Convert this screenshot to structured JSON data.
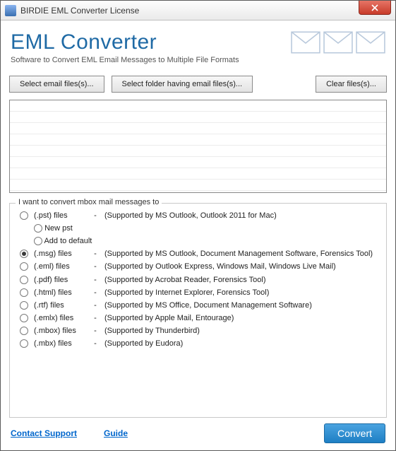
{
  "window": {
    "title": "BIRDIE EML Converter License"
  },
  "header": {
    "title": "EML Converter",
    "subtitle": "Software to Convert EML Email Messages to Multiple File Formats"
  },
  "buttons": {
    "select_files": "Select email files(s)...",
    "select_folder": "Select folder having email files(s)...",
    "clear": "Clear files(s)..."
  },
  "group": {
    "title": "I want to convert mbox mail messages to"
  },
  "options": [
    {
      "key": "pst",
      "label": "(.pst) files",
      "dash": "-",
      "desc": "(Supported by MS Outlook, Outlook 2011 for Mac)",
      "checked": false,
      "sub": [
        {
          "key": "newpst",
          "label": "New pst",
          "checked": false
        },
        {
          "key": "addpst",
          "label": "Add to default",
          "checked": false
        }
      ]
    },
    {
      "key": "msg",
      "label": "(.msg) files",
      "dash": "-",
      "desc": "(Supported by MS Outlook, Document Management Software, Forensics Tool)",
      "checked": true
    },
    {
      "key": "eml",
      "label": "(.eml) files",
      "dash": "-",
      "desc": "(Supported by Outlook Express,  Windows Mail, Windows Live Mail)",
      "checked": false
    },
    {
      "key": "pdf",
      "label": "(.pdf) files",
      "dash": "-",
      "desc": "(Supported by Acrobat Reader, Forensics Tool)",
      "checked": false
    },
    {
      "key": "html",
      "label": "(.html) files",
      "dash": "-",
      "desc": "(Supported by Internet Explorer, Forensics Tool)",
      "checked": false
    },
    {
      "key": "rtf",
      "label": "(.rtf) files",
      "dash": "-",
      "desc": "(Supported by MS Office, Document Management Software)",
      "checked": false
    },
    {
      "key": "emlx",
      "label": "(.emlx) files",
      "dash": "-",
      "desc": "(Supported by Apple Mail, Entourage)",
      "checked": false
    },
    {
      "key": "mbox",
      "label": "(.mbox) files",
      "dash": "-",
      "desc": "(Supported by Thunderbird)",
      "checked": false
    },
    {
      "key": "mbx",
      "label": "(.mbx) files",
      "dash": "-",
      "desc": "(Supported by Eudora)",
      "checked": false
    }
  ],
  "footer": {
    "contact": "Contact Support",
    "guide": "Guide",
    "convert": "Convert"
  }
}
